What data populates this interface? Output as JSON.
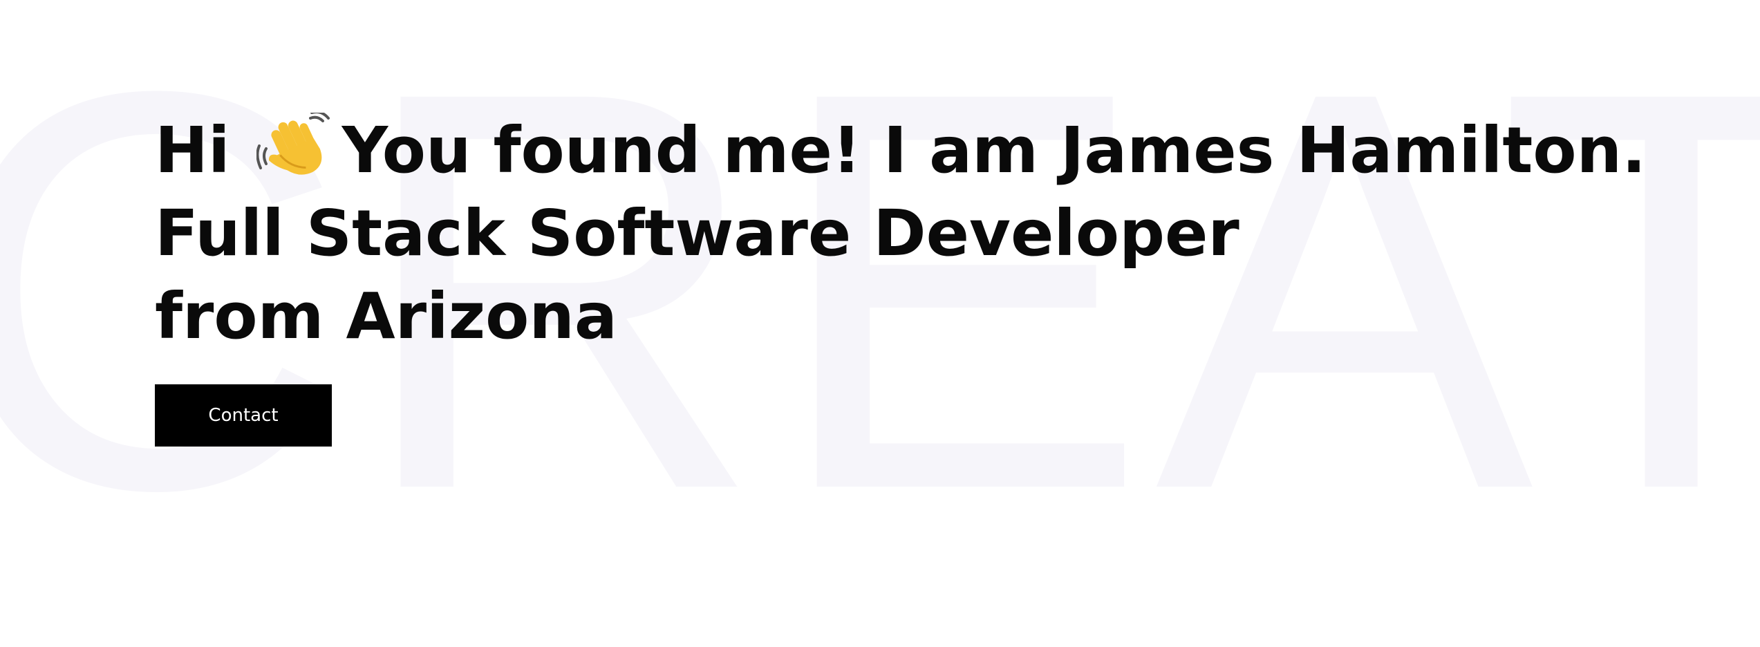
{
  "background": {
    "word": "CREATIVE",
    "color": "#f6f5fa"
  },
  "hero": {
    "greeting_hi": "Hi",
    "greeting_icon": "waving-hand-icon",
    "greeting_rest": "You found me! I am James Hamilton.",
    "line2": "Full Stack Software Developer",
    "line3": "from Arizona",
    "text_color": "#0a0a0a"
  },
  "contact_button": {
    "label": "Contact",
    "bg_color": "#000000",
    "text_color": "#ffffff"
  }
}
